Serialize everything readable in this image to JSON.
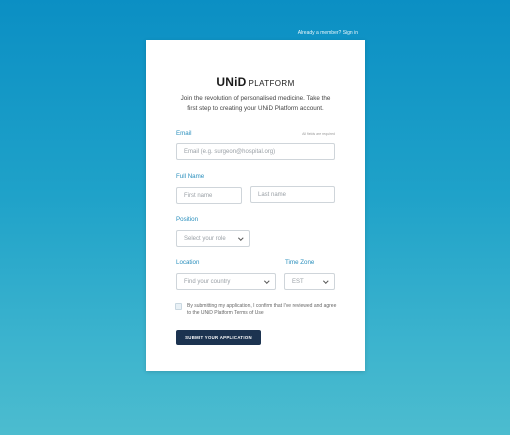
{
  "topbar": {
    "signin_link": "Already a member? Sign in"
  },
  "brand": {
    "name": "UNiD",
    "suffix": "PLATFORM"
  },
  "intro": "Join the revolution of personalised medicine. Take the first step to creating your UNiD Platform account.",
  "required_note": "All fields are required",
  "form": {
    "email": {
      "label": "Email",
      "placeholder": "Email (e.g. surgeon@hospital.org)"
    },
    "fullname": {
      "label": "Full Name",
      "first_placeholder": "First name",
      "last_placeholder": "Last name"
    },
    "position": {
      "label": "Position",
      "value": "Select your role"
    },
    "location": {
      "label": "Location",
      "value": "Find your country"
    },
    "timezone": {
      "label": "Time Zone",
      "value": "EST"
    },
    "terms": "By submitting my application, I confirm that I've reviewed and agree to the UNiD Platform Terms of Use",
    "submit": "SUBMIT YOUR APPLICATION"
  },
  "colors": {
    "accent": "#2a8fbd",
    "button": "#1c3350",
    "background_top": "#0b8fc4",
    "background_bottom": "#4cbccf"
  }
}
